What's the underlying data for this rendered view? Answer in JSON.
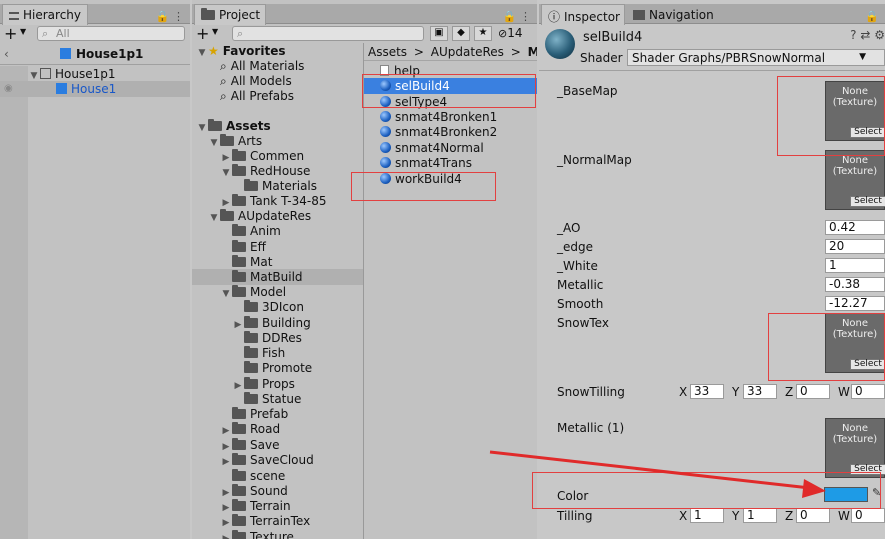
{
  "hierarchy": {
    "tab_label": "Hierarchy",
    "search_placeholder": "All",
    "scene_name": "House1p1",
    "items": [
      {
        "label": "House1p1"
      },
      {
        "label": "House1"
      }
    ]
  },
  "project": {
    "tab_label": "Project",
    "badge_count": "14",
    "favorites": {
      "label": "Favorites",
      "items": [
        "All Materials",
        "All Models",
        "All Prefabs"
      ]
    },
    "assets_label": "Assets",
    "tree": [
      {
        "label": "Arts"
      },
      {
        "label": "Commen"
      },
      {
        "label": "RedHouse"
      },
      {
        "label": "Materials"
      },
      {
        "label": "Tank T-34-85"
      },
      {
        "label": "AUpdateRes"
      },
      {
        "label": "Anim"
      },
      {
        "label": "Eff"
      },
      {
        "label": "Mat"
      },
      {
        "label": "MatBuild"
      },
      {
        "label": "Model"
      },
      {
        "label": "3DIcon"
      },
      {
        "label": "Building"
      },
      {
        "label": "DDRes"
      },
      {
        "label": "Fish"
      },
      {
        "label": "Promote"
      },
      {
        "label": "Props"
      },
      {
        "label": "Statue"
      },
      {
        "label": "Prefab"
      },
      {
        "label": "Road"
      },
      {
        "label": "Save"
      },
      {
        "label": "SaveCloud"
      },
      {
        "label": "scene"
      },
      {
        "label": "Sound"
      },
      {
        "label": "Terrain"
      },
      {
        "label": "TerrainTex"
      },
      {
        "label": "Texture"
      }
    ],
    "breadcrumb": [
      "Assets",
      "AUpdateRes",
      "MatBu"
    ],
    "files": [
      {
        "label": "help"
      },
      {
        "label": "selBuild4"
      },
      {
        "label": "selType4"
      },
      {
        "label": "snmat4Bronken1"
      },
      {
        "label": "snmat4Bronken2"
      },
      {
        "label": "snmat4Normal"
      },
      {
        "label": "snmat4Trans"
      },
      {
        "label": "workBuild4"
      }
    ]
  },
  "inspector": {
    "tab_label": "Inspector",
    "nav_tab_label": "Navigation",
    "material_name": "selBuild4",
    "shader_label": "Shader",
    "shader_value": "Shader Graphs/PBRSnowNormal",
    "none_texture": "None\n(Texture)",
    "select_label": "Select",
    "props": {
      "basemap": "_BaseMap",
      "normalmap": "_NormalMap",
      "ao": {
        "label": "_AO",
        "value": "0.42"
      },
      "edge": {
        "label": "_edge",
        "value": "20"
      },
      "white": {
        "label": "_White",
        "value": "1"
      },
      "metallic": {
        "label": "Metallic",
        "value": "-0.38"
      },
      "smooth": {
        "label": "Smooth",
        "value": "-12.27"
      },
      "snowtex": "SnowTex",
      "snowtilling": {
        "label": "SnowTilling",
        "x": "33",
        "y": "33",
        "z": "0",
        "w": "0"
      },
      "metallic1": "Metallic (1)",
      "color": {
        "label": "Color",
        "value": "#1e9be6"
      },
      "tilling": {
        "label": "Tilling",
        "x": "1",
        "y": "1",
        "z": "0",
        "w": "0"
      }
    },
    "axis": {
      "x": "X",
      "y": "Y",
      "z": "Z",
      "w": "W"
    }
  },
  "colors": {
    "selection": "#3a80e0",
    "highlight_box": "#e24040",
    "arrow": "#e02a2a"
  }
}
